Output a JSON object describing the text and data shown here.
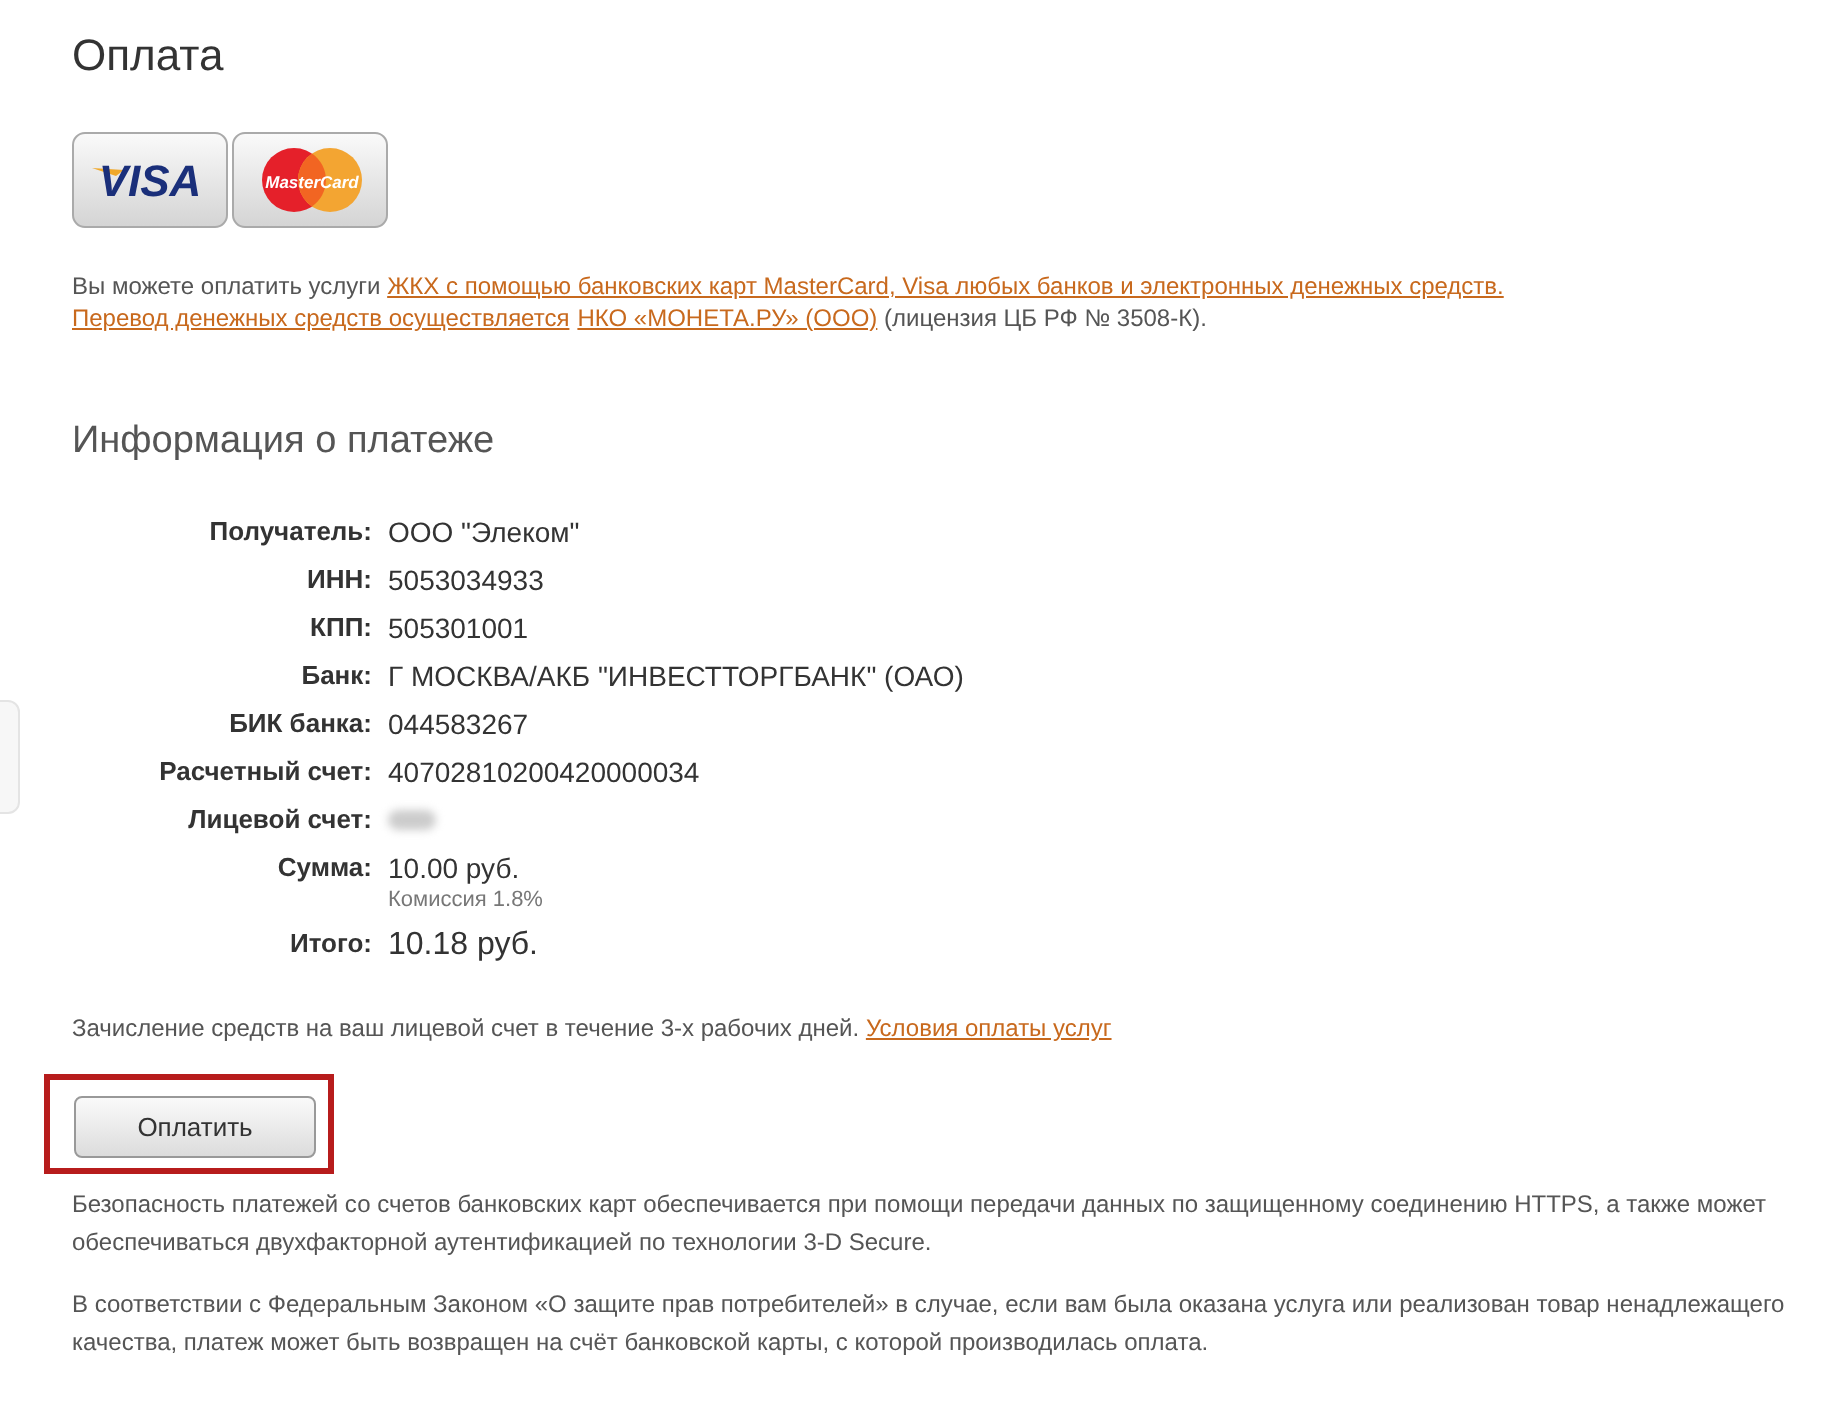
{
  "title": "Оплата",
  "cards": [
    {
      "kind": "visa",
      "label": "VISA"
    },
    {
      "kind": "mastercard",
      "label": "MasterCard"
    }
  ],
  "intro": [
    [
      {
        "kind": "text",
        "text": "Вы можете оплатить услуги "
      },
      {
        "kind": "link",
        "text": "ЖКХ с помощью банковских карт MasterCard, Visa любых банков и электронных денежных средств."
      }
    ],
    [
      {
        "kind": "link",
        "text": "Перевод денежных средств осуществляется"
      },
      {
        "kind": "link",
        "text": "НКО «МОНЕТА.РУ» (ООО)"
      },
      {
        "kind": "text",
        "text": " (лицензия ЦБ РФ № 3508-К)."
      }
    ]
  ],
  "section_title": "Информация о платеже",
  "details": [
    {
      "label": "Получатель:",
      "value": "ООО \"Элеком\""
    },
    {
      "label": "ИНН:",
      "value": "5053034933"
    },
    {
      "label": "КПП:",
      "value": "505301001"
    },
    {
      "label": "Банк:",
      "value": "Г МОСКВА/АКБ \"ИНВЕСТТОРГБАНК\" (ОАО)"
    },
    {
      "label": "БИК банка:",
      "value": "044583267"
    },
    {
      "label": "Расчетный счет:",
      "value": "40702810200420000034"
    },
    {
      "label": "Лицевой счет:",
      "blurred": true
    },
    {
      "label": "Сумма:",
      "value": "10.00 руб.",
      "note": "Комиссия 1.8%"
    },
    {
      "label": "Итого:",
      "value": "10.18 руб.",
      "emphasis": true
    }
  ],
  "notice": [
    {
      "kind": "text",
      "text": "Зачисление средств на ваш лицевой счет в течение 3-х рабочих дней. "
    },
    {
      "kind": "link",
      "text": "Условия оплаты услуг"
    }
  ],
  "pay_button": {
    "label": "Оплатить",
    "highlighted": true
  },
  "paragraphs": [
    "Безопасность платежей со счетов банковских карт обеспечивается при помощи передачи данных по защищенному соединению HTTPS, а также может обеспечиваться двухфакторной аутентификацией по технологии 3-D Secure.",
    "В соответствии с Федеральным Законом «О защите прав потребителей» в случае, если вам была оказана услуга или реализован товар ненадлежащего качества, платеж может быть возвращен на счёт банковской карты, с которой производилась оплата."
  ]
}
